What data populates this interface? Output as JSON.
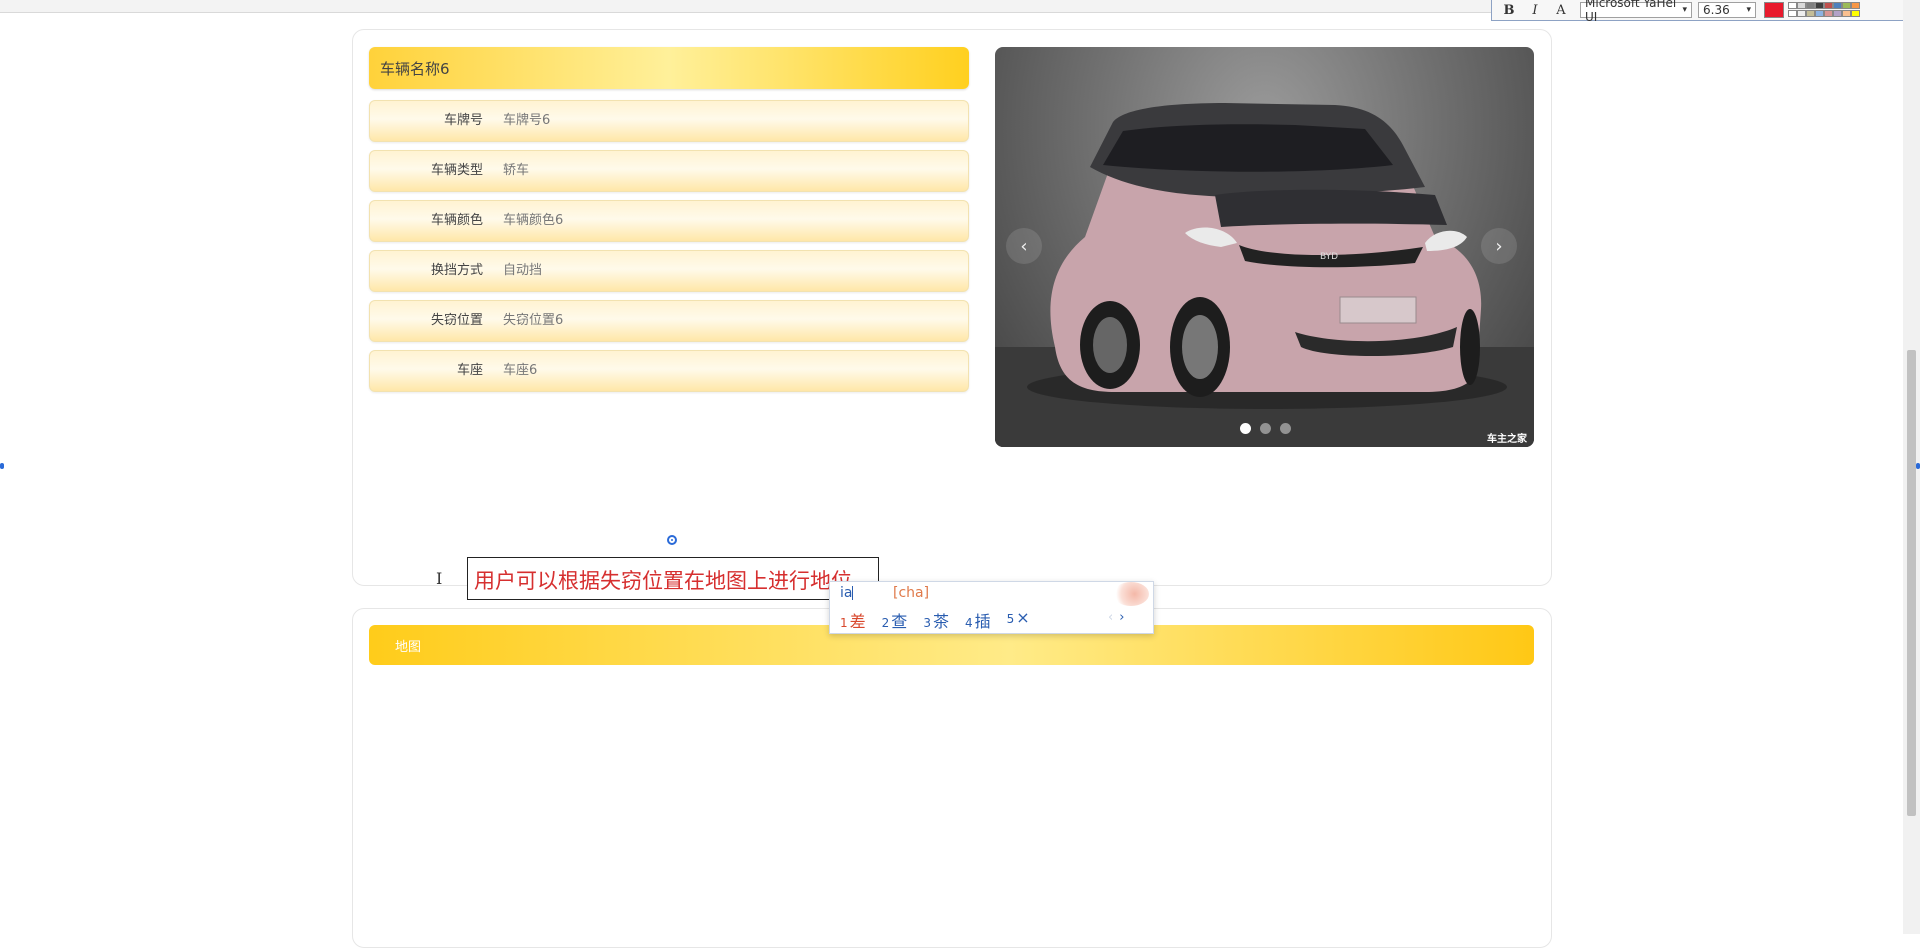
{
  "format_toolbar": {
    "bold_label": "B",
    "italic_label": "I",
    "effect_label": "A",
    "font_family_value": "Microsoft YaHei UI",
    "font_size_value": "6.36",
    "font_color": "#e8192c",
    "swatch_colors": [
      "#ffffff",
      "#d9d9d9",
      "#7f7f7f",
      "#3f3f3f",
      "#c0504d",
      "#4f81bd",
      "#9bbb59",
      "#f79646",
      "#ffffff",
      "#eeeeee",
      "#c4bd97",
      "#8db3e2",
      "#d99694",
      "#b2a2c7",
      "#fac08f",
      "#ffff00"
    ]
  },
  "vehicle": {
    "name": "车辆名称6",
    "fields": [
      {
        "label": "车牌号",
        "value": "车牌号6"
      },
      {
        "label": "车辆类型",
        "value": "轿车"
      },
      {
        "label": "车辆颜色",
        "value": "车辆颜色6"
      },
      {
        "label": "换挡方式",
        "value": "自动挡"
      },
      {
        "label": "失窃位置",
        "value": "失窃位置6"
      },
      {
        "label": "车座",
        "value": "车座6"
      }
    ]
  },
  "carousel": {
    "prev_glyph": "‹",
    "next_glyph": "›",
    "active_index": 0,
    "slide_count": 3,
    "watermark": "车主之家",
    "badge_text": "BYD"
  },
  "editor": {
    "textbox_text": "用户可以根据失窃位置在地图上进行地位",
    "text_color": "#d62f2f"
  },
  "ime": {
    "composition": "ia",
    "pinyin": "[cha]",
    "candidates": [
      {
        "num": "1",
        "text": "差"
      },
      {
        "num": "2",
        "text": "查"
      },
      {
        "num": "3",
        "text": "茶"
      },
      {
        "num": "4",
        "text": "插"
      },
      {
        "num": "5",
        "text": "×"
      }
    ],
    "prev_glyph": "‹",
    "next_glyph": "›"
  },
  "map_section": {
    "title": "地图"
  }
}
